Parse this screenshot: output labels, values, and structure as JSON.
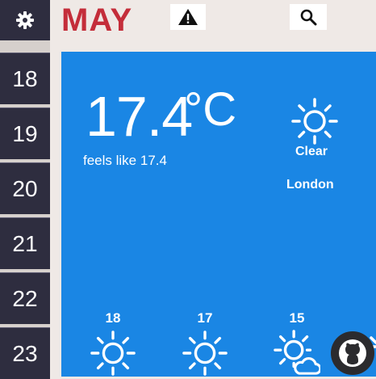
{
  "header": {
    "month": "MAY"
  },
  "sidebar": {
    "days": [
      "18",
      "19",
      "20",
      "21",
      "22",
      "23"
    ]
  },
  "current": {
    "temperature": "17.4",
    "unit": "°C",
    "feels_like": "feels like 17.4",
    "condition": "Clear",
    "city": "London"
  },
  "forecast": [
    {
      "label": "18",
      "icon": "sun-icon"
    },
    {
      "label": "17",
      "icon": "sun-icon"
    },
    {
      "label": "15",
      "icon": "sun-cloud-icon"
    }
  ],
  "colors": {
    "accent": "#c42d3a",
    "panel": "#1a86e4",
    "sidebar": "#2e2d3f"
  },
  "icons": [
    "gear-icon",
    "warning-icon",
    "search-icon",
    "github-icon"
  ]
}
